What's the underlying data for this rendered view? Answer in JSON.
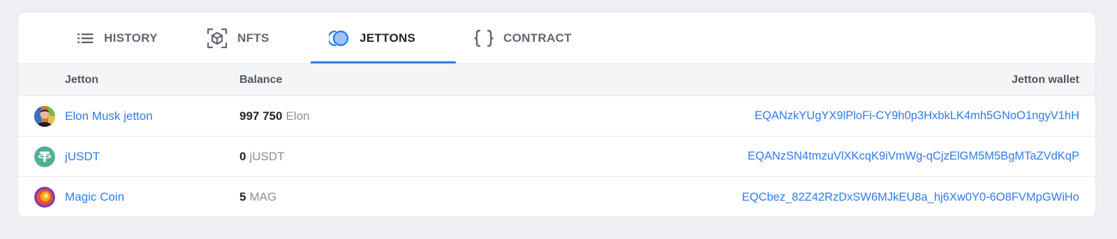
{
  "tabs": [
    {
      "label": "HISTORY",
      "icon": "list-icon",
      "active": false
    },
    {
      "label": "NFTS",
      "icon": "cube-icon",
      "active": false
    },
    {
      "label": "JETTONS",
      "icon": "coin-icon",
      "active": true
    },
    {
      "label": "CONTRACT",
      "icon": "braces-icon",
      "active": false
    }
  ],
  "table": {
    "headers": {
      "jetton": "Jetton",
      "balance": "Balance",
      "wallet": "Jetton wallet"
    },
    "rows": [
      {
        "name": "Elon Musk jetton",
        "amount": "997 750",
        "symbol": "Elon",
        "wallet": "EQANzkYUgYX9lPloFi-CY9h0p3HxbkLK4mh5GNoO1ngyV1hH",
        "avatar": "elon-avatar"
      },
      {
        "name": "jUSDT",
        "amount": "0",
        "symbol": "jUSDT",
        "wallet": "EQANzSN4tmzuVlXKcqK9iVmWg-qCjzElGM5M5BgMTaZVdKqP",
        "avatar": "tether-avatar"
      },
      {
        "name": "Magic Coin",
        "amount": "5",
        "symbol": "MAG",
        "wallet": "EQCbez_82Z42RzDxSW6MJkEU8a_hj6Xw0Y0-6O8FVMpGWiHo",
        "avatar": "magic-coin-avatar"
      }
    ]
  },
  "colors": {
    "accent": "#2d7cf2",
    "tether": "#50af95"
  }
}
